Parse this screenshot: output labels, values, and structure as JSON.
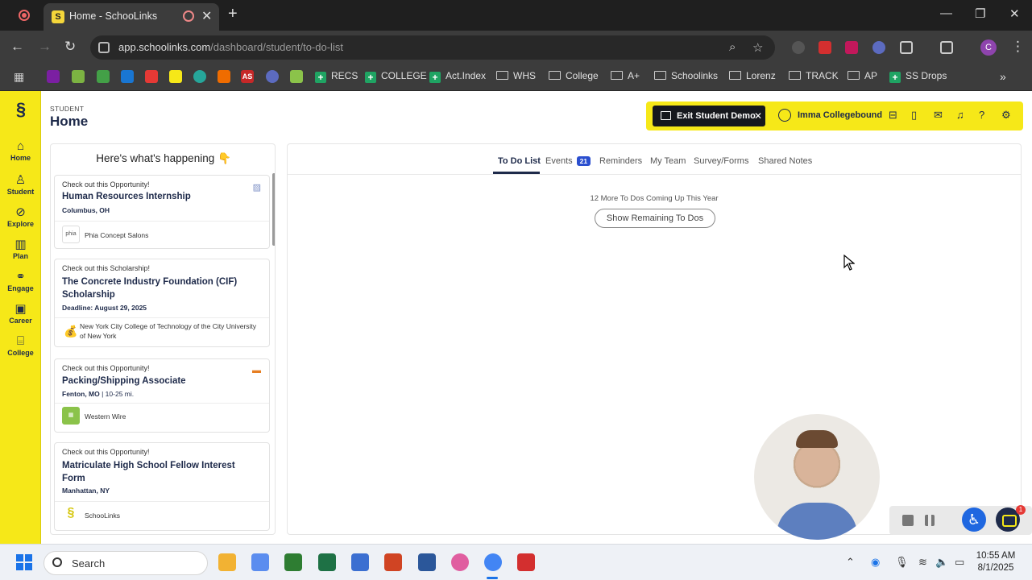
{
  "browser": {
    "tab_title": "Home - SchooLinks",
    "favicon_letter": "S",
    "url_host": "app.schoolinks.com",
    "url_path": "/dashboard/student/to-do-list",
    "profile_letter": "C",
    "bookmarks": [
      {
        "label": "RECS",
        "kind": "plus"
      },
      {
        "label": "COLLEGE",
        "kind": "plus"
      },
      {
        "label": "Act.Index",
        "kind": "plus"
      },
      {
        "label": "WHS",
        "kind": "folder"
      },
      {
        "label": "College",
        "kind": "folder"
      },
      {
        "label": "A+",
        "kind": "folder"
      },
      {
        "label": "Schoolinks",
        "kind": "folder"
      },
      {
        "label": "Lorenz",
        "kind": "folder"
      },
      {
        "label": "TRACK",
        "kind": "folder"
      },
      {
        "label": "AP",
        "kind": "folder"
      },
      {
        "label": "SS Drops",
        "kind": "plus"
      }
    ],
    "bookmark_ext_labels": {
      "as": "AS"
    }
  },
  "sidebar": {
    "items": [
      {
        "label": "Home",
        "icon": "home-icon"
      },
      {
        "label": "Student",
        "icon": "student-icon"
      },
      {
        "label": "Explore",
        "icon": "compass-icon"
      },
      {
        "label": "Plan",
        "icon": "book-icon"
      },
      {
        "label": "Engage",
        "icon": "handshake-icon"
      },
      {
        "label": "Career",
        "icon": "briefcase-icon"
      },
      {
        "label": "College",
        "icon": "college-icon"
      }
    ]
  },
  "header": {
    "eyebrow": "STUDENT",
    "title": "Home"
  },
  "demo_bar": {
    "exit_label": "Exit Student Demo",
    "user_name": "Imma Collegebound"
  },
  "feed": {
    "title": "Here's what's happening 👇",
    "cards": [
      {
        "kicker": "Check out this Opportunity!",
        "title": "Human Resources Internship",
        "meta": "Columbus, OH",
        "meta_extra": "",
        "org": "Phia Concept Salons",
        "org_logo": "phia"
      },
      {
        "kicker": "Check out this Scholarship!",
        "title": "The Concrete Industry Foundation (CIF) Scholarship",
        "meta": "Deadline: August 29, 2025",
        "meta_extra": "",
        "org": "New York City College of Technology of the City University of New York",
        "org_logo": ""
      },
      {
        "kicker": "Check out this Opportunity!",
        "title": "Packing/Shipping Associate",
        "meta": "Fenton, MO",
        "meta_extra": " | 10-25 mi.",
        "org": "Western Wire",
        "org_logo": ""
      },
      {
        "kicker": "Check out this Opportunity!",
        "title": "Matriculate High School Fellow Interest Form",
        "meta": "Manhattan, NY",
        "meta_extra": "",
        "org": "SchooLinks",
        "org_logo": ""
      }
    ]
  },
  "main": {
    "tabs": [
      {
        "label": "To Do List",
        "active": true
      },
      {
        "label": "Events",
        "badge": "21"
      },
      {
        "label": "Reminders"
      },
      {
        "label": "My Team"
      },
      {
        "label": "Survey/Forms"
      },
      {
        "label": "Shared Notes"
      }
    ],
    "upcoming_text": "12 More To Dos Coming Up This Year",
    "show_remaining_label": "Show Remaining To Dos"
  },
  "widgets": {
    "chat_badge": "1"
  },
  "taskbar": {
    "search_placeholder": "Search",
    "time": "10:55 AM",
    "date": "8/1/2025"
  },
  "colors": {
    "brand_yellow": "#f6e818",
    "brand_navy": "#1e2a4a",
    "badge_blue": "#2b4fcf"
  }
}
